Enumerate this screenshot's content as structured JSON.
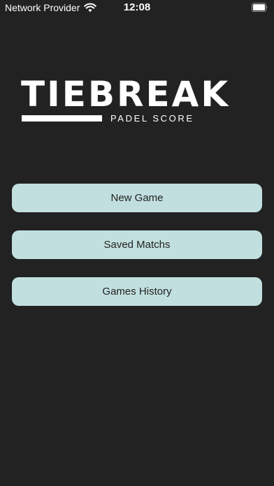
{
  "status_bar": {
    "carrier": "Network Provider",
    "time": "12:08",
    "icons": [
      "wifi-icon",
      "battery-icon"
    ]
  },
  "logo": {
    "title": "TIEBREAK",
    "subtitle": "PADEL SCORE"
  },
  "menu": {
    "new_game": "New Game",
    "saved_matchs": "Saved Matchs",
    "games_history": "Games History"
  },
  "colors": {
    "background": "#222222",
    "button": "#c2dfdf",
    "button_text": "#222222",
    "text": "#ffffff"
  }
}
